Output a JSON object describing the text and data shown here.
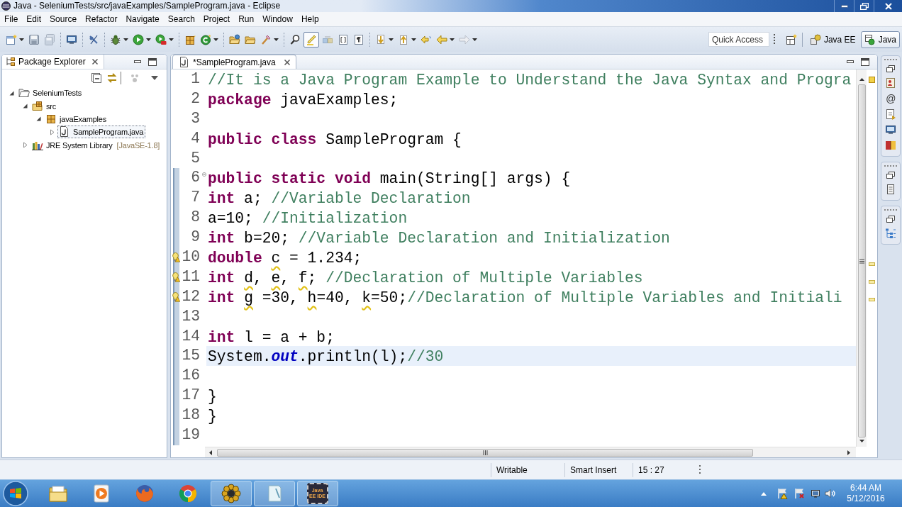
{
  "window": {
    "title": "Java - SeleniumTests/src/javaExamples/SampleProgram.java - Eclipse"
  },
  "menu": [
    "File",
    "Edit",
    "Source",
    "Refactor",
    "Navigate",
    "Search",
    "Project",
    "Run",
    "Window",
    "Help"
  ],
  "toolbar": {
    "toggle": {
      "pressed": true
    },
    "quick_access": {
      "placeholder": "Quick Access"
    },
    "perspectives": [
      {
        "label": "Java EE",
        "selected": false
      },
      {
        "label": "Java",
        "selected": true
      }
    ]
  },
  "package_explorer": {
    "title": "Package Explorer",
    "tree": [
      {
        "kind": "project",
        "label": "SeleniumTests",
        "expanded": true,
        "selected": false,
        "children": [
          {
            "kind": "source_folder",
            "label": "src",
            "expanded": true,
            "selected": false,
            "children": [
              {
                "kind": "package",
                "label": "javaExamples",
                "expanded": true,
                "selected": false,
                "children": [
                  {
                    "kind": "java_file",
                    "label": "SampleProgram.java",
                    "expanded": false,
                    "selected": true
                  }
                ]
              }
            ]
          },
          {
            "kind": "library",
            "label": "JRE System Library",
            "suffix": "[JavaSE-1.8]",
            "expanded": false,
            "selected": false
          }
        ]
      }
    ]
  },
  "editor": {
    "tab": {
      "title": "*SampleProgram.java",
      "selected": true
    },
    "lines": [
      {
        "number": "1",
        "segments": [
          {
            "kind": "comment",
            "text": "//It is a Java Program Example to Understand the Java Syntax and Progra"
          }
        ],
        "current": false,
        "in_scope": false,
        "warning": false,
        "collapsible": false
      },
      {
        "number": "2",
        "segments": [
          {
            "kind": "keyword",
            "text": "package"
          },
          {
            "kind": "plain",
            "text": " javaExamples;"
          }
        ],
        "current": false,
        "in_scope": false,
        "warning": false,
        "collapsible": false
      },
      {
        "number": "3",
        "current": false,
        "in_scope": false,
        "warning": false,
        "collapsible": false
      },
      {
        "number": "4",
        "segments": [
          {
            "kind": "keyword",
            "text": "public class"
          },
          {
            "kind": "plain",
            "text": " SampleProgram {"
          }
        ],
        "current": false,
        "in_scope": false,
        "warning": false,
        "collapsible": false
      },
      {
        "number": "5",
        "current": false,
        "in_scope": false,
        "warning": false,
        "collapsible": false
      },
      {
        "number": "6",
        "segments": [
          {
            "kind": "keyword",
            "text": "public static void"
          },
          {
            "kind": "plain",
            "text": " main(String[] args) {"
          }
        ],
        "current": false,
        "in_scope": true,
        "warning": false,
        "collapsible": true
      },
      {
        "number": "7",
        "segments": [
          {
            "kind": "keyword",
            "text": "int"
          },
          {
            "kind": "plain",
            "text": " a; "
          },
          {
            "kind": "comment",
            "text": "//Variable Declaration"
          }
        ],
        "current": false,
        "in_scope": true,
        "warning": false,
        "collapsible": false
      },
      {
        "number": "8",
        "segments": [
          {
            "kind": "plain",
            "text": "a=10; "
          },
          {
            "kind": "comment",
            "text": "//Initialization"
          }
        ],
        "current": false,
        "in_scope": true,
        "warning": false,
        "collapsible": false
      },
      {
        "number": "9",
        "segments": [
          {
            "kind": "keyword",
            "text": "int"
          },
          {
            "kind": "plain",
            "text": " b=20; "
          },
          {
            "kind": "comment",
            "text": "//Variable Declaration and Initialization"
          }
        ],
        "current": false,
        "in_scope": true,
        "warning": false,
        "collapsible": false
      },
      {
        "number": "10",
        "segments": [
          {
            "kind": "keyword",
            "text": "double "
          },
          {
            "kind": "unused",
            "text": "c"
          },
          {
            "kind": "plain",
            "text": " = 1.234;"
          }
        ],
        "current": false,
        "in_scope": true,
        "warning": true,
        "collapsible": false
      },
      {
        "number": "11",
        "segments": [
          {
            "kind": "keyword",
            "text": "int "
          },
          {
            "kind": "unused",
            "text": "d"
          },
          {
            "kind": "plain",
            "text": ", "
          },
          {
            "kind": "unused",
            "text": "e"
          },
          {
            "kind": "plain",
            "text": ", "
          },
          {
            "kind": "unused",
            "text": "f"
          },
          {
            "kind": "plain",
            "text": "; "
          },
          {
            "kind": "comment",
            "text": "//Declaration of Multiple Variables"
          }
        ],
        "current": false,
        "in_scope": true,
        "warning": true,
        "collapsible": false
      },
      {
        "number": "12",
        "segments": [
          {
            "kind": "keyword",
            "text": "int "
          },
          {
            "kind": "unused",
            "text": "g"
          },
          {
            "kind": "plain",
            "text": " =30, "
          },
          {
            "kind": "unused",
            "text": "h"
          },
          {
            "kind": "plain",
            "text": "=40, "
          },
          {
            "kind": "unused",
            "text": "k"
          },
          {
            "kind": "plain",
            "text": "=50;"
          },
          {
            "kind": "comment",
            "text": "//Declaration of Multiple Variables and Initiali"
          }
        ],
        "current": false,
        "in_scope": true,
        "warning": true,
        "collapsible": false
      },
      {
        "number": "13",
        "current": false,
        "in_scope": true,
        "warning": false,
        "collapsible": false
      },
      {
        "number": "14",
        "segments": [
          {
            "kind": "keyword",
            "text": "int"
          },
          {
            "kind": "plain",
            "text": " l = a + b;"
          }
        ],
        "current": false,
        "in_scope": true,
        "warning": false,
        "collapsible": false
      },
      {
        "number": "15",
        "segments": [
          {
            "kind": "plain",
            "text": "System."
          },
          {
            "kind": "field",
            "text": "out"
          },
          {
            "kind": "plain",
            "text": ".println(l);"
          },
          {
            "kind": "comment",
            "text": "//30"
          }
        ],
        "current": true,
        "in_scope": true,
        "warning": false,
        "collapsible": false
      },
      {
        "number": "16",
        "current": false,
        "in_scope": true,
        "warning": false,
        "collapsible": false
      },
      {
        "number": "17",
        "segments": [
          {
            "kind": "plain",
            "text": "}"
          }
        ],
        "current": false,
        "in_scope": true,
        "warning": false,
        "collapsible": false
      },
      {
        "number": "18",
        "segments": [
          {
            "kind": "plain",
            "text": "}"
          }
        ],
        "current": false,
        "in_scope": true,
        "warning": false,
        "collapsible": false
      },
      {
        "number": "19",
        "current": false,
        "in_scope": true,
        "warning": false,
        "collapsible": false
      }
    ]
  },
  "right_trim": {
    "glyph": "@"
  },
  "status_bar": [
    "Writable",
    "Smart Insert",
    "15 : 27"
  ],
  "taskbar": {
    "apps": [
      {
        "running": false
      },
      {
        "running": false
      },
      {
        "running": false
      },
      {
        "running": false
      },
      {
        "running": true
      },
      {
        "running": true
      },
      {
        "running": true,
        "icon_text": "Java EE IDE"
      }
    ],
    "clock": {
      "time": "6:44 AM",
      "date": "5/12/2016"
    }
  }
}
